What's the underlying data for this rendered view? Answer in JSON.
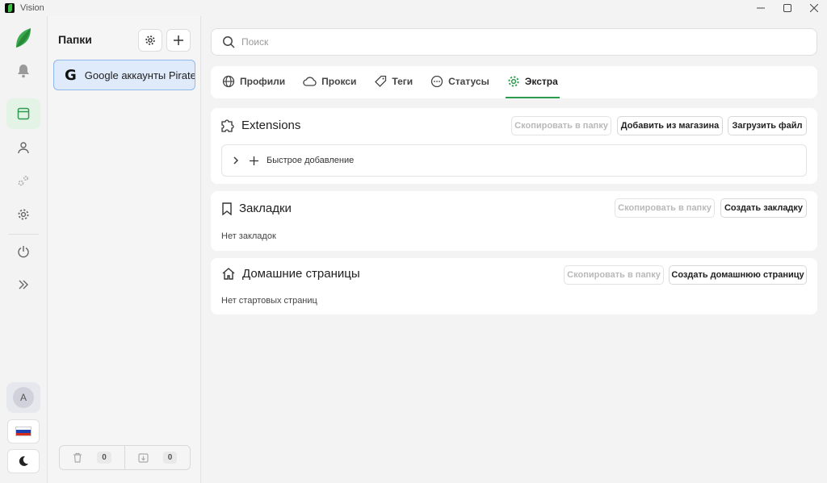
{
  "window": {
    "title": "Vision",
    "controls": [
      "minimize-icon",
      "maximize-icon",
      "close-icon"
    ]
  },
  "rail": {
    "items": [
      "bell-icon",
      "browser-profiles-icon",
      "user-icon",
      "gears-icon",
      "settings-icon",
      "power-icon",
      "expand-icon"
    ],
    "active": "browser-profiles-icon",
    "avatar_letter": "A",
    "language_flag": "ru-flag",
    "theme_toggle": "moon-icon"
  },
  "folders": {
    "title": "Папки",
    "items": [
      {
        "icon": "G",
        "label": "Google аккаунты Pirate"
      }
    ],
    "trash_count": "0",
    "archive_count": "0"
  },
  "search": {
    "placeholder": "Поиск",
    "value": ""
  },
  "tabs": [
    {
      "label": "Профили",
      "icon": "globe-icon"
    },
    {
      "label": "Прокси",
      "icon": "cloud-icon"
    },
    {
      "label": "Теги",
      "icon": "tag-icon"
    },
    {
      "label": "Статусы",
      "icon": "dots-circle-icon"
    },
    {
      "label": "Экстра",
      "icon": "gear-icon",
      "active": true
    }
  ],
  "extensions": {
    "title": "Extensions",
    "copy_button": "Скопировать в папку",
    "add_store_button": "Добавить из магазина",
    "upload_button": "Загрузить файл",
    "quick_add": "Быстрое добавление"
  },
  "bookmarks": {
    "title": "Закладки",
    "copy_button": "Скопировать в папку",
    "create_button": "Создать закладку",
    "empty_text": "Нет закладок"
  },
  "homepages": {
    "title": "Домашние страницы",
    "copy_button": "Скопировать в папку",
    "create_button": "Создать домашнюю страницу",
    "empty_text": "Нет стартовых страниц"
  },
  "colors": {
    "accent": "#2e9c4e",
    "selected_folder_bg": "#dfeafb",
    "selected_folder_border": "#8fb8ee"
  }
}
